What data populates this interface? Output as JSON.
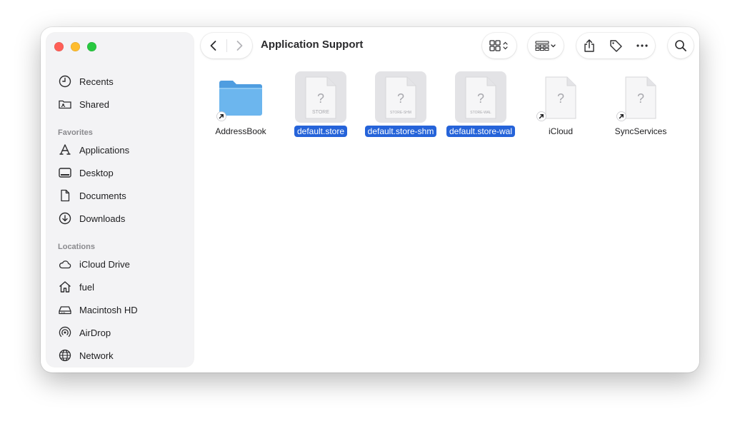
{
  "window": {
    "title": "Application Support"
  },
  "sidebar": {
    "top_items": [
      {
        "label": "Recents",
        "icon": "clock-icon"
      },
      {
        "label": "Shared",
        "icon": "shared-folder-icon"
      }
    ],
    "favorites_header": "Favorites",
    "favorites": [
      {
        "label": "Applications",
        "icon": "applications-icon"
      },
      {
        "label": "Desktop",
        "icon": "desktop-icon"
      },
      {
        "label": "Documents",
        "icon": "document-icon"
      },
      {
        "label": "Downloads",
        "icon": "download-icon"
      }
    ],
    "locations_header": "Locations",
    "locations": [
      {
        "label": "iCloud Drive",
        "icon": "cloud-icon"
      },
      {
        "label": "fuel",
        "icon": "home-icon"
      },
      {
        "label": "Macintosh HD",
        "icon": "disk-icon"
      },
      {
        "label": "AirDrop",
        "icon": "airdrop-icon"
      },
      {
        "label": "Network",
        "icon": "globe-icon"
      }
    ]
  },
  "files": [
    {
      "name": "AddressBook",
      "kind": "folder",
      "alias": true,
      "selected": false
    },
    {
      "name": "default.store",
      "kind": "unknown",
      "badge": "STORE",
      "alias": false,
      "selected": true
    },
    {
      "name": "default.store-shm",
      "kind": "unknown",
      "badge": "STORE-SHM",
      "alias": false,
      "selected": true
    },
    {
      "name": "default.store-wal",
      "kind": "unknown",
      "badge": "STORE-WAL",
      "alias": false,
      "selected": true
    },
    {
      "name": "iCloud",
      "kind": "unknown",
      "alias": true,
      "selected": false
    },
    {
      "name": "SyncServices",
      "kind": "unknown",
      "alias": true,
      "selected": false
    }
  ],
  "colors": {
    "selection": "#2563d9",
    "folder": "#5aa9e6",
    "close": "#ff5f57",
    "minimize": "#febc2e",
    "maximize": "#28c840"
  }
}
